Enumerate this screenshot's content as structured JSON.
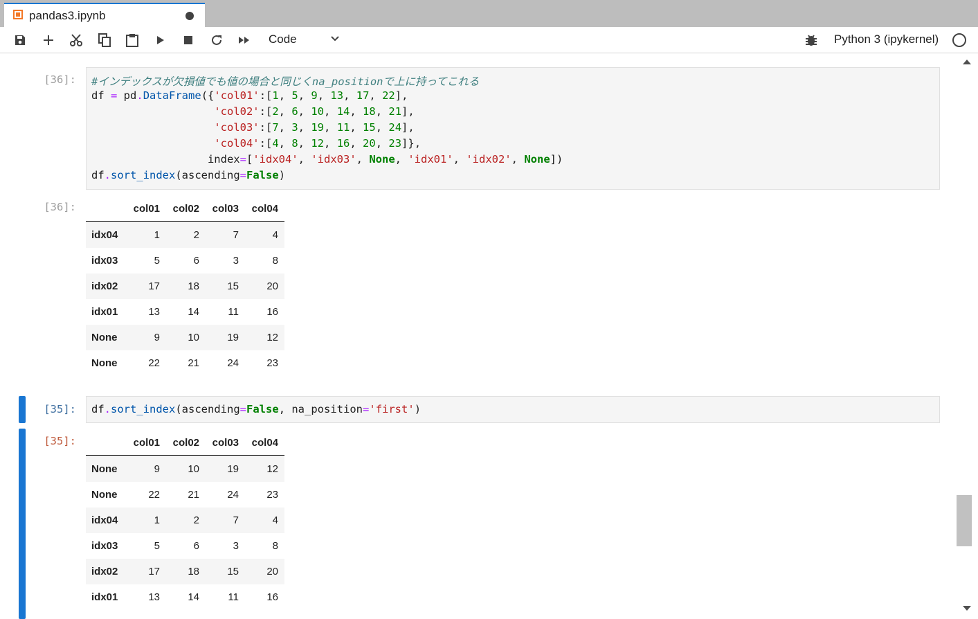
{
  "tab": {
    "title": "pandas3.ipynb",
    "icon": "notebook-icon"
  },
  "toolbar": {
    "buttons": [
      "save-icon",
      "plus-icon",
      "scissors-icon",
      "copy-icon",
      "paste-icon",
      "run-icon",
      "stop-icon",
      "restart-icon",
      "fast-forward-icon"
    ],
    "cell_type": "Code",
    "kernel": "Python 3 (ipykernel)"
  },
  "cells": [
    {
      "in_prompt": "[36]:",
      "out_prompt": "[36]:",
      "code": [
        "#インデックスが欠損値でも値の場合と同じくna_positionで上に持ってこれる",
        "df = pd.DataFrame({'col01':[1, 5, 9, 13, 17, 22],",
        "                   'col02':[2, 6, 10, 14, 18, 21],",
        "                   'col03':[7, 3, 19, 11, 15, 24],",
        "                   'col04':[4, 8, 12, 16, 20, 23]},",
        "                  index=['idx04', 'idx03', None, 'idx01', 'idx02', None])",
        "df.sort_index(ascending=False)"
      ],
      "table": {
        "columns": [
          "col01",
          "col02",
          "col03",
          "col04"
        ],
        "rows": [
          {
            "index": "idx04",
            "values": [
              "1",
              "2",
              "7",
              "4"
            ]
          },
          {
            "index": "idx03",
            "values": [
              "5",
              "6",
              "3",
              "8"
            ]
          },
          {
            "index": "idx02",
            "values": [
              "17",
              "18",
              "15",
              "20"
            ]
          },
          {
            "index": "idx01",
            "values": [
              "13",
              "14",
              "11",
              "16"
            ]
          },
          {
            "index": "None",
            "values": [
              "9",
              "10",
              "19",
              "12"
            ]
          },
          {
            "index": "None",
            "values": [
              "22",
              "21",
              "24",
              "23"
            ]
          }
        ]
      }
    },
    {
      "in_prompt": "[35]:",
      "out_prompt": "[35]:",
      "code": [
        "df.sort_index(ascending=False, na_position='first')"
      ],
      "table": {
        "columns": [
          "col01",
          "col02",
          "col03",
          "col04"
        ],
        "rows": [
          {
            "index": "None",
            "values": [
              "9",
              "10",
              "19",
              "12"
            ]
          },
          {
            "index": "None",
            "values": [
              "22",
              "21",
              "24",
              "23"
            ]
          },
          {
            "index": "idx04",
            "values": [
              "1",
              "2",
              "7",
              "4"
            ]
          },
          {
            "index": "idx03",
            "values": [
              "5",
              "6",
              "3",
              "8"
            ]
          },
          {
            "index": "idx02",
            "values": [
              "17",
              "18",
              "15",
              "20"
            ]
          },
          {
            "index": "idx01",
            "values": [
              "13",
              "14",
              "11",
              "16"
            ]
          }
        ]
      }
    }
  ]
}
